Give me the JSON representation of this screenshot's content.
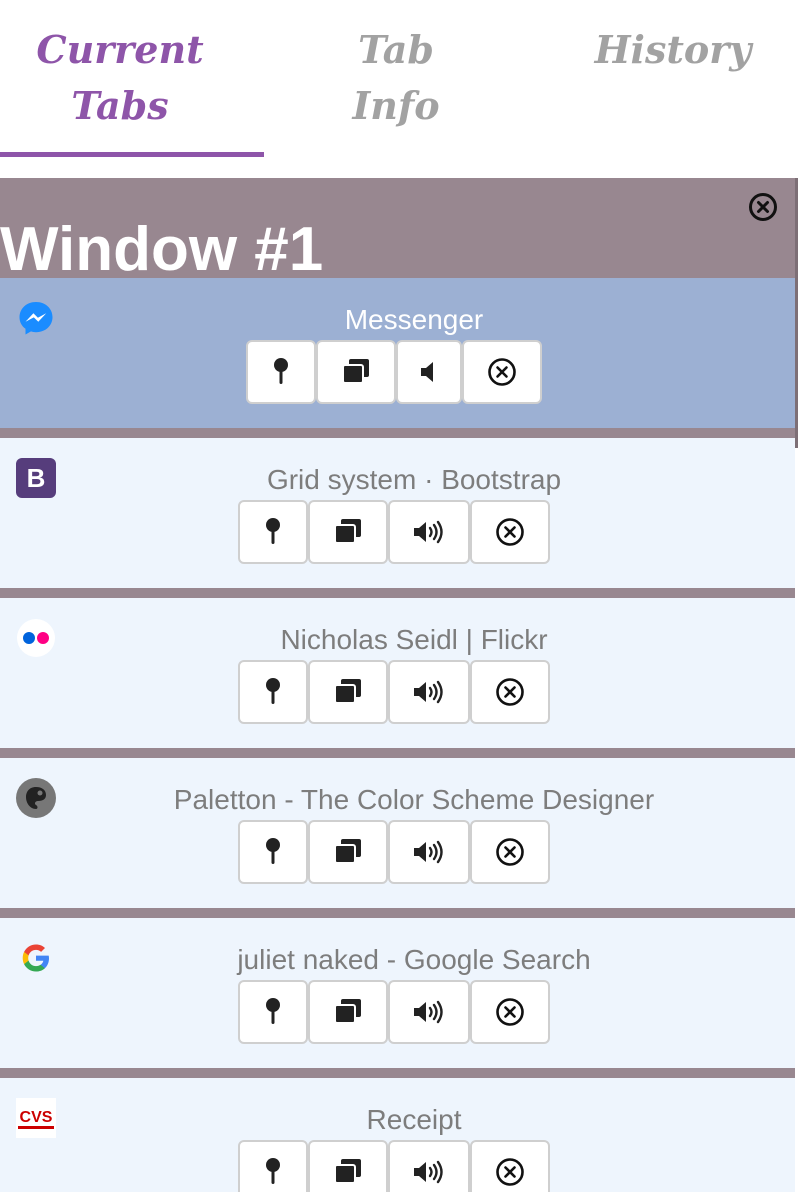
{
  "nav": {
    "tabs": [
      {
        "line1": "Current",
        "line2": "Tabs",
        "active": true
      },
      {
        "line1": "Tab",
        "line2": "Info",
        "active": false
      },
      {
        "line1": "History",
        "line2": "",
        "active": false
      }
    ]
  },
  "window": {
    "title": "Window #1",
    "close_icon": "close-circle-icon",
    "tabs": [
      {
        "title": "Messenger",
        "favicon": "messenger-icon",
        "active": true,
        "sound_icon": "speaker-muted-icon"
      },
      {
        "title": "Grid system · Bootstrap",
        "favicon": "bootstrap-icon",
        "active": false,
        "sound_icon": "speaker-on-icon"
      },
      {
        "title": "Nicholas Seidl | Flickr",
        "favicon": "flickr-icon",
        "active": false,
        "sound_icon": "speaker-on-icon"
      },
      {
        "title": "Paletton - The Color Scheme Designer",
        "favicon": "paletton-icon",
        "active": false,
        "sound_icon": "speaker-on-icon"
      },
      {
        "title": "juliet naked - Google Search",
        "favicon": "google-icon",
        "active": false,
        "sound_icon": "speaker-on-icon"
      },
      {
        "title": "Receipt",
        "favicon": "cvs-icon",
        "active": false,
        "sound_icon": "speaker-on-icon"
      }
    ],
    "button_icons": [
      "pin-icon",
      "duplicate-icon",
      "sound-icon",
      "close-circle-icon"
    ],
    "favicon_text": {
      "bootstrap": "B",
      "cvs": "CVS"
    }
  },
  "colors": {
    "accent": "#8e55a9",
    "window_bg": "#988790",
    "active_tab_bg": "#9cb0d3",
    "tab_bg": "#eef5fd",
    "inactive_nav": "#a2a2a2"
  }
}
